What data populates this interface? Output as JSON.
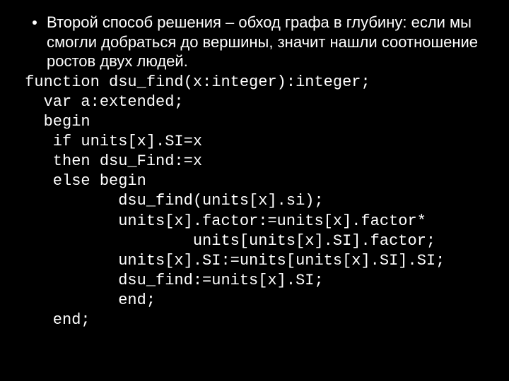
{
  "bullet": {
    "text": "Второй способ решения – обход графа в глубину: если мы смогли добраться до вершины, значит нашли соотношение ростов двух людей."
  },
  "code": {
    "lines": [
      " function dsu_find(x:integer):integer;",
      "   var a:extended;",
      "   begin",
      "    if units[x].SI=x",
      "    then dsu_Find:=x",
      "    else begin",
      "           dsu_find(units[x].si);",
      "           units[x].factor:=units[x].factor*",
      "                   units[units[x].SI].factor;",
      "           units[x].SI:=units[units[x].SI].SI;",
      "           dsu_find:=units[x].SI;",
      "           end;",
      "    end;"
    ]
  }
}
